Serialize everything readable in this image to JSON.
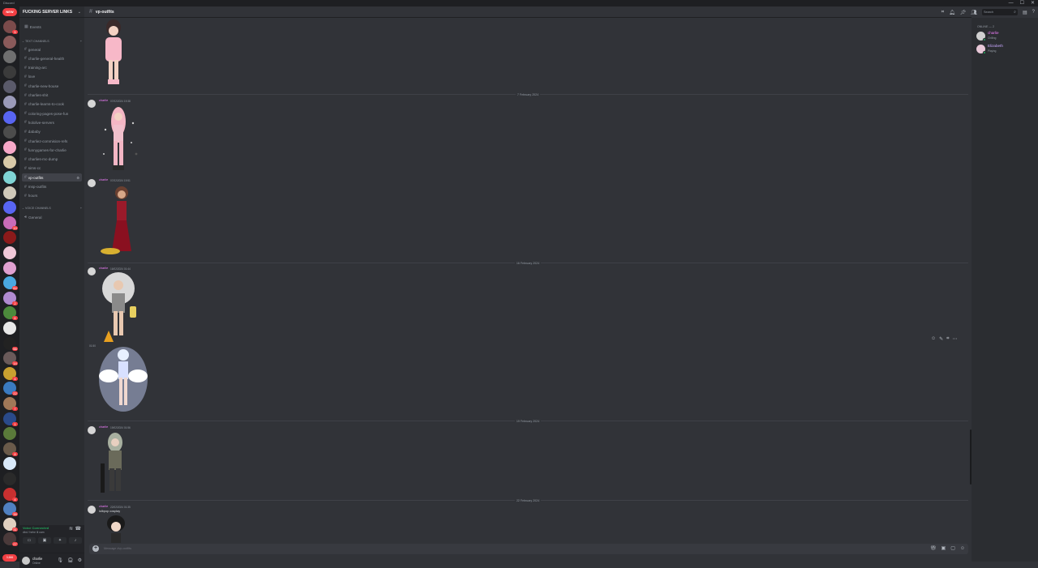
{
  "window": {
    "app_label": "Discord",
    "controls": [
      "—",
      "☐",
      "✕"
    ]
  },
  "rail": {
    "home_badge": "NEW",
    "servers": [
      {
        "color": "#7b4b4b",
        "badge": "5"
      },
      {
        "color": "#8a5a5a",
        "badge": ""
      },
      {
        "color": "#6f6f6f",
        "badge": ""
      },
      {
        "color": "#3b3b3b",
        "badge": ""
      },
      {
        "color": "#5a5a6a",
        "badge": ""
      },
      {
        "color": "#9a9ab8",
        "badge": ""
      },
      {
        "color": "#5865f2",
        "badge": ""
      },
      {
        "color": "#4c4c4c",
        "badge": ""
      },
      {
        "color": "#f7a8c8",
        "badge": ""
      },
      {
        "color": "#d9c9a8",
        "badge": ""
      },
      {
        "color": "#7fd4d4",
        "badge": ""
      },
      {
        "color": "#cfc8b8",
        "badge": ""
      },
      {
        "color": "#5865f2",
        "badge": ""
      },
      {
        "color": "#c86cb8",
        "badge": "19"
      },
      {
        "color": "#8b1a1a",
        "badge": ""
      },
      {
        "color": "#f0c8d8",
        "badge": ""
      },
      {
        "color": "#e0a0d0",
        "badge": ""
      },
      {
        "color": "#4aa8e0",
        "badge": "84"
      },
      {
        "color": "#b08ad0",
        "badge": "2"
      },
      {
        "color": "#4c8a3c",
        "badge": "6"
      },
      {
        "color": "#e8e8e8",
        "badge": ""
      },
      {
        "color": "#222222",
        "badge": "56"
      },
      {
        "color": "#6a5a5a",
        "badge": "14"
      },
      {
        "color": "#c8a030",
        "badge": "4"
      },
      {
        "color": "#3a7ac0",
        "badge": "22"
      },
      {
        "color": "#a07858",
        "badge": "7"
      },
      {
        "color": "#2a4a8a",
        "badge": "1"
      },
      {
        "color": "#5a7a3a",
        "badge": ""
      },
      {
        "color": "#6a5a4a",
        "badge": "8"
      },
      {
        "color": "#d8e8f8",
        "badge": ""
      },
      {
        "color": "#2a2a2a",
        "badge": ""
      },
      {
        "color": "#c83030",
        "badge": "4"
      },
      {
        "color": "#5080c0",
        "badge": "38"
      },
      {
        "color": "#e0d0c0",
        "badge": "31"
      },
      {
        "color": "#4a3a3a",
        "badge": "27"
      }
    ],
    "bottom_badge": "3,666"
  },
  "sidebar": {
    "guild_name": "FUCKING SERVER LINKS",
    "events_label": "Events",
    "text_category": "TEXT CHANNELS",
    "voice_category": "VOICE CHANNELS",
    "text_channels": [
      "general",
      "charlie-general-health",
      "training-arc",
      "love",
      "charlie-new-house",
      "charlies-shit",
      "charlie-learns-to-cook",
      "coloring-pages-pose-fun",
      "hololive-servers",
      "dababy",
      "charliez-commision-refs",
      "funnygames-for-charlie",
      "charlies-mc-dump",
      "sims-cc",
      "vp-outfits",
      "msp-outfits",
      "hours"
    ],
    "active_channel": "vp-outfits",
    "voice_channels": [
      "General"
    ],
    "voice_status": "Voice Connected",
    "voice_sub": "dbd / hehe lil cam",
    "user_name": "charlie",
    "user_status": "Online"
  },
  "header": {
    "channel": "vp-outfits",
    "search_placeholder": "Search"
  },
  "messages": {
    "dividers": [
      "7 February 2024",
      "16 February 2024",
      "19 February 2024",
      "22 February 2024"
    ],
    "author": "charlie",
    "timestamps": [
      "07/02/2024 19:38",
      "07/02/2024 19:51",
      "16/02/2024 01:44",
      "19/02/2024 01:56",
      "22/02/2024 01:35"
    ],
    "side_time": "01:50",
    "last_text": "lolbpop cosplay",
    "composer_placeholder": "Message #vp-outfits"
  },
  "members": {
    "header": "ONLINE — 2",
    "list": [
      {
        "name": "charlie",
        "status": "Chilling",
        "color": "#f47fff"
      },
      {
        "name": "Elizabeth",
        "status": "Playing",
        "color": "#c9a8ff"
      }
    ]
  }
}
